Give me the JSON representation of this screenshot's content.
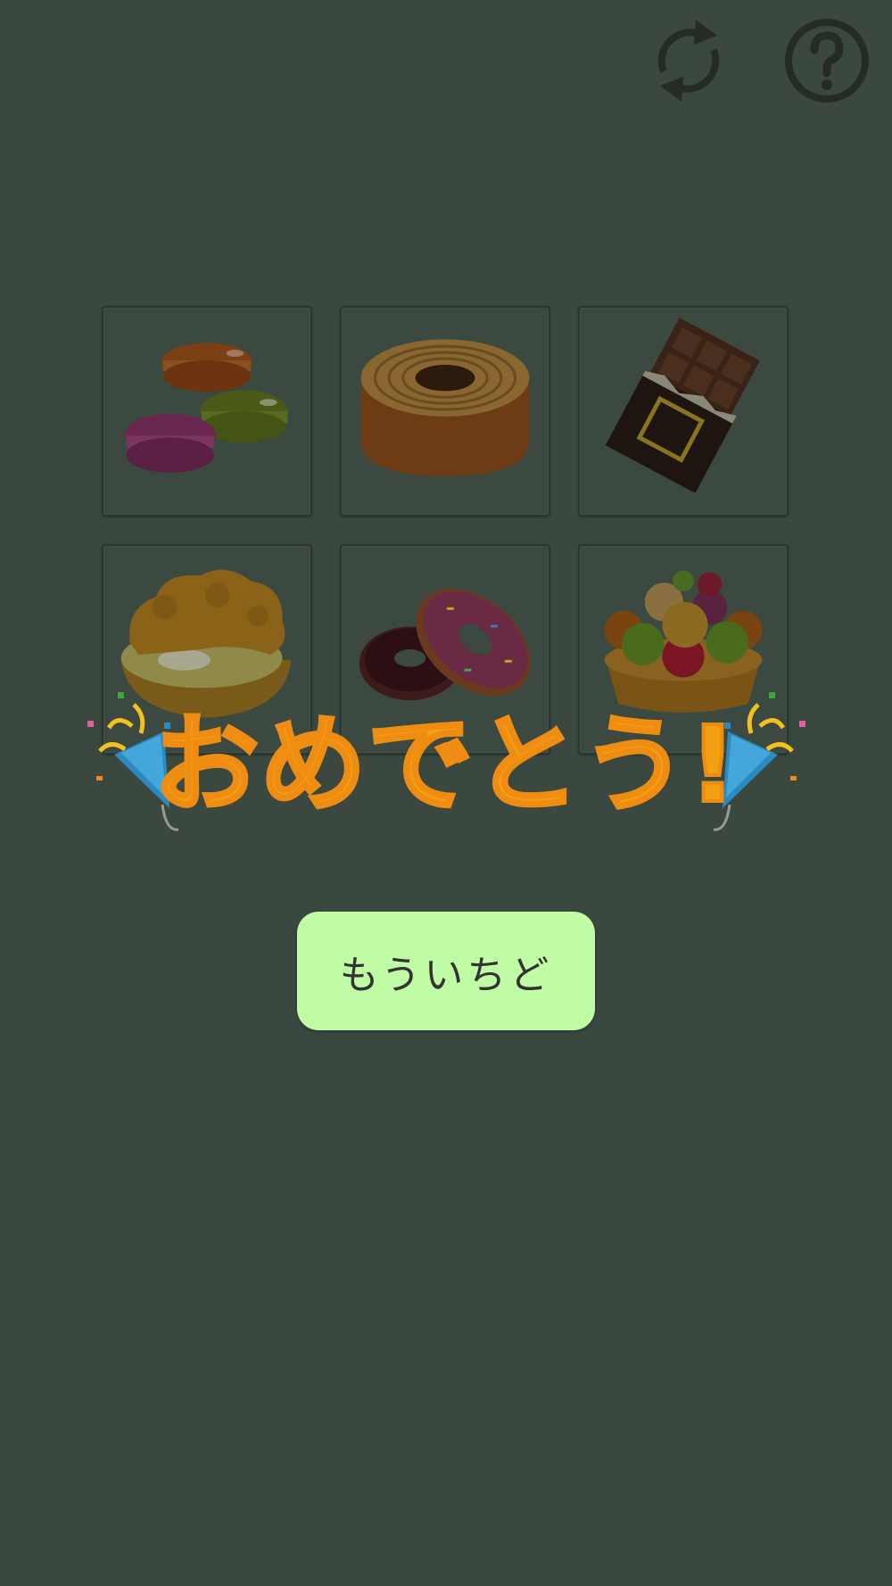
{
  "toolbar": {
    "reset_icon": "refresh-icon",
    "help_icon": "help-icon"
  },
  "sweets": [
    {
      "name": "macarons"
    },
    {
      "name": "baumkuchen"
    },
    {
      "name": "chocolate-bar"
    },
    {
      "name": "cream-puff"
    },
    {
      "name": "donuts"
    },
    {
      "name": "fruit-tart"
    }
  ],
  "banner": {
    "text": "おめでとう!"
  },
  "retry_button": {
    "label": "もういちど"
  },
  "colors": {
    "background": "#3a4840",
    "banner": "#f3a012",
    "button": "#c0fca6",
    "icon": "#262b27"
  }
}
